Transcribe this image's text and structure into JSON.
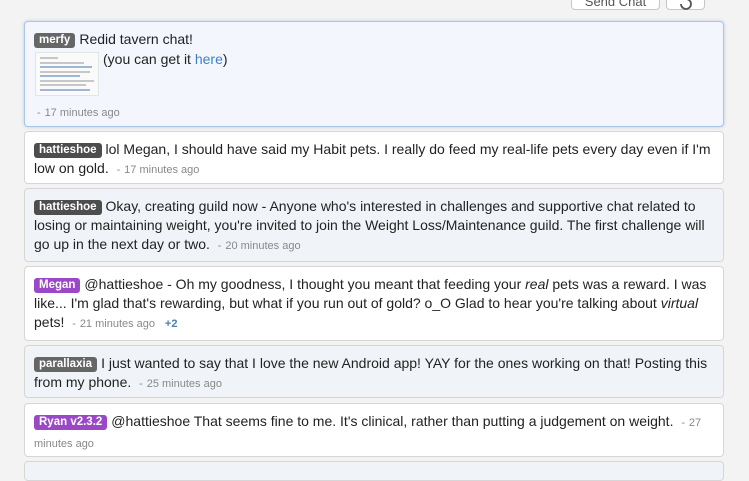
{
  "toolbar": {
    "send_label": "Send Chat"
  },
  "messages": [
    {
      "user": "merfy",
      "text_lines": [
        "Redid tavern chat!"
      ],
      "sub_text": "(you can get it ",
      "link": "here",
      "sub_text_end": ")",
      "dash": "-",
      "time": "17 minutes ago"
    },
    {
      "user": "hattieshoe",
      "text": "lol Megan, I should have said my Habit pets. I really do feed my real-life pets every day even if I'm low on gold.",
      "dash": "-",
      "time": "17 minutes ago"
    },
    {
      "user": "hattieshoe",
      "text": "Okay, creating guild now - Anyone who's interested in challenges and supportive chat related to losing or maintaining weight, you're invited to join the Weight Loss/Maintenance guild. The first challenge will go up in the next day or two.",
      "dash": "-",
      "time": "20 minutes ago"
    },
    {
      "user": "Megan",
      "text_a": "@hattieshoe - Oh my goodness, I thought you meant that feeding your ",
      "em_a": "real",
      "text_b": " pets was a reward. I was like... I'm glad that's rewarding, but what if you run out of gold? o_O Glad to hear you're talking about ",
      "em_b": "virtual",
      "text_c": " pets!",
      "dash": "-",
      "time": "21 minutes ago",
      "plus": "+2"
    },
    {
      "user": "parallaxia",
      "text": "I just wanted to say that I love the new Android app! YAY for the ones working on that! Posting this from my phone.",
      "dash": "-",
      "time": "25 minutes ago"
    },
    {
      "user": "Ryan v2.3.2",
      "text": "@hattieshoe That seems fine to me. It's clinical, rather than putting a judgement on weight.",
      "dash": "-",
      "time": "27 minutes ago"
    }
  ],
  "colors": {
    "label_gray": "#666666",
    "label_dark": "#4d4d4d",
    "label_purple": "#9a48c8",
    "link": "#3f80c4",
    "highlight_border": "#a9c5ea"
  }
}
